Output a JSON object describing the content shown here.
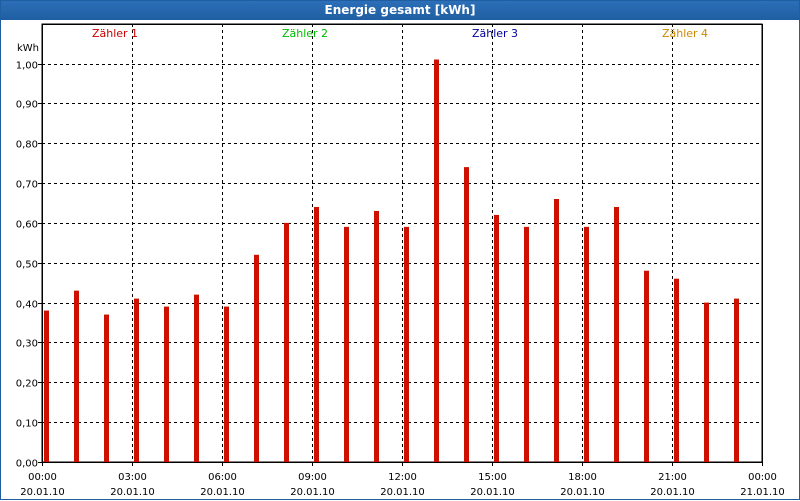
{
  "window": {
    "title": "Energie gesamt [kWh]"
  },
  "chart_data": {
    "type": "bar",
    "title": "Energie gesamt [kWh]",
    "ylabel": "kWh",
    "xlabel": "",
    "ylim": [
      0,
      1.0
    ],
    "grid": true,
    "legend_position": "top",
    "y_ticks": [
      "0,00",
      "0,10",
      "0,20",
      "0,30",
      "0,40",
      "0,50",
      "0,60",
      "0,70",
      "0,80",
      "0,90",
      "1,00"
    ],
    "x_ticks": [
      {
        "time": "00:00",
        "date": "20.01.10"
      },
      {
        "time": "03:00",
        "date": "20.01.10"
      },
      {
        "time": "06:00",
        "date": "20.01.10"
      },
      {
        "time": "09:00",
        "date": "20.01.10"
      },
      {
        "time": "12:00",
        "date": "20.01.10"
      },
      {
        "time": "15:00",
        "date": "20.01.10"
      },
      {
        "time": "18:00",
        "date": "20.01.10"
      },
      {
        "time": "21:00",
        "date": "20.01.10"
      },
      {
        "time": "00:00",
        "date": "21.01.10"
      }
    ],
    "legend": [
      {
        "label": "Zähler 1",
        "color": "#cc0000"
      },
      {
        "label": "Zähler 2",
        "color": "#00bb00"
      },
      {
        "label": "Zähler 3",
        "color": "#000099"
      },
      {
        "label": "Zähler 4",
        "color": "#cc8800"
      }
    ],
    "bar_color": "#cc1100",
    "x": [
      "00:00",
      "01:00",
      "02:00",
      "03:00",
      "04:00",
      "05:00",
      "06:00",
      "07:00",
      "08:00",
      "09:00",
      "10:00",
      "11:00",
      "12:00",
      "13:00",
      "14:00",
      "15:00",
      "16:00",
      "17:00",
      "18:00",
      "19:00",
      "20:00",
      "21:00",
      "22:00",
      "23:00"
    ],
    "values": [
      0.38,
      0.43,
      0.37,
      0.41,
      0.39,
      0.42,
      0.39,
      0.52,
      0.6,
      0.64,
      0.59,
      0.63,
      0.59,
      1.01,
      0.74,
      0.62,
      0.59,
      0.66,
      0.59,
      0.64,
      0.48,
      0.46,
      0.4,
      0.41
    ]
  }
}
